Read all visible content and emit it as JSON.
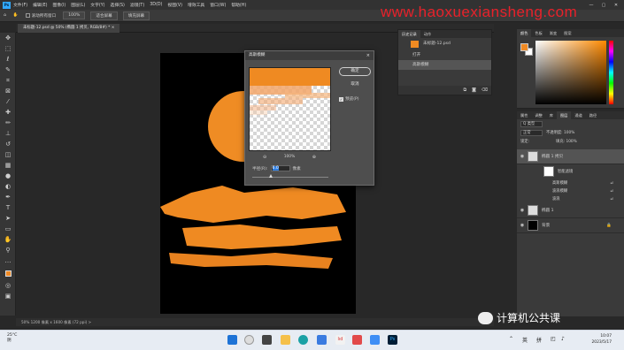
{
  "menubar": {
    "logo": "Ps",
    "items": [
      "文件(F)",
      "编辑(E)",
      "图像(I)",
      "图层(L)",
      "文字(Y)",
      "选择(S)",
      "滤镜(T)",
      "3D(D)",
      "视图(V)",
      "增效工具",
      "窗口(W)",
      "帮助(H)"
    ],
    "window_buttons": [
      "—",
      "▢",
      "✕"
    ]
  },
  "optionsbar": {
    "scroll_all": "滚动所有窗口",
    "zoom": "100%",
    "fit_screen": "适合屏幕",
    "fill_screen": "填充屏幕"
  },
  "watermark": "www.haoxuexiansheng.com",
  "document": {
    "tab_title": "未标题-12.psd @ 50% (椭圆 1 拷贝, RGB/8#) *  ×",
    "status": "50%      1200 像素 x 1600 像素 (72 ppi)    >"
  },
  "dialog": {
    "title": "高斯模糊",
    "close": "×",
    "ok": "确定",
    "cancel": "取消",
    "preview_label": "预览(P)",
    "preview_checked": true,
    "zoom_out": "⊖",
    "zoom_level": "100%",
    "zoom_in": "⊕",
    "radius_label": "半径(R):",
    "radius_value": "6.0",
    "radius_unit": "像素",
    "radius_fraction": 0.24
  },
  "history": {
    "tabs": [
      "历史记录",
      "动作"
    ],
    "snapshot": "未标题-12.psd",
    "items": [
      {
        "label": "打开",
        "selected": false
      },
      {
        "label": "高斯模糊",
        "selected": true
      }
    ]
  },
  "color_panel": {
    "tabs": [
      "颜色",
      "色板",
      "渐变",
      "图案"
    ],
    "foreground": "#f08a24",
    "background": "#ffffff"
  },
  "layers_panel": {
    "tabs": [
      "属性",
      "调整",
      "库",
      "图层",
      "通道",
      "路径"
    ],
    "filter": "Q 类型",
    "blend": "正常",
    "opacity": "不透明度: 100%",
    "lock": "锁定:",
    "fill": "填充: 100%",
    "layers": [
      {
        "name": "椭圆 1 拷贝",
        "selected": true,
        "thumb": "transparent"
      },
      {
        "name": "椭圆 1",
        "selected": false,
        "thumb": "transparent"
      },
      {
        "name": "背景",
        "selected": false,
        "thumb": "black"
      }
    ],
    "smart_filters_label": "智能滤镜",
    "smart_filters": [
      "高斯模糊",
      "波浪模糊",
      "波浪"
    ]
  },
  "wechat": {
    "label": "计算机公共课"
  },
  "taskbar": {
    "temperature": "25°C",
    "weather": "阴",
    "ime": "英",
    "ime2": "拼",
    "time": "10:07",
    "date": "2023/5/17"
  }
}
